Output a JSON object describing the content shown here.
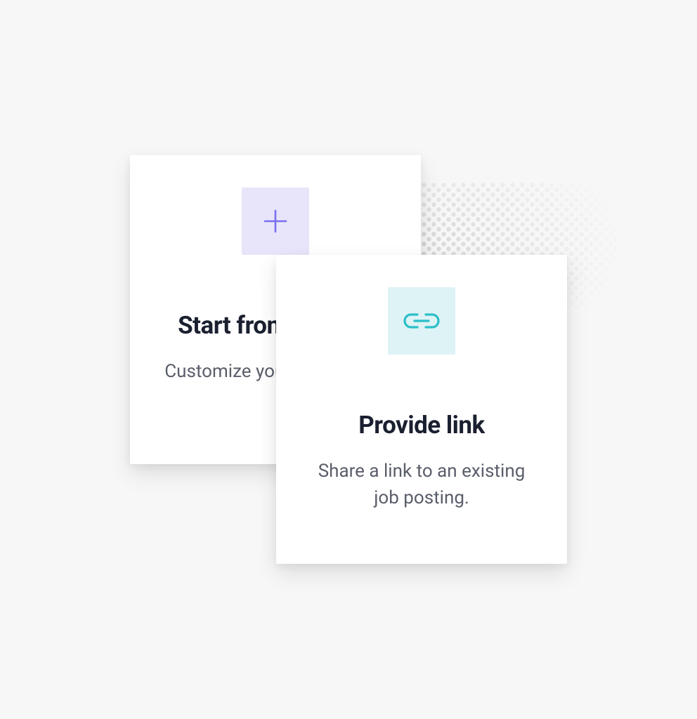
{
  "cards": {
    "start": {
      "icon": "plus-icon",
      "title": "Start from scratch",
      "description": "Customize your description"
    },
    "link": {
      "icon": "link-icon",
      "title": "Provide link",
      "description": "Share a link to an existing job posting."
    }
  },
  "colors": {
    "bg": "#f7f7f7",
    "card": "#ffffff",
    "tile_purple": "#e8e5fa",
    "tile_teal": "#def3f5",
    "icon_purple": "#7a6ff0",
    "icon_teal": "#2bbfc8",
    "title": "#1b2030",
    "desc": "#5a5e6a",
    "dots": "#d7d7d7"
  }
}
